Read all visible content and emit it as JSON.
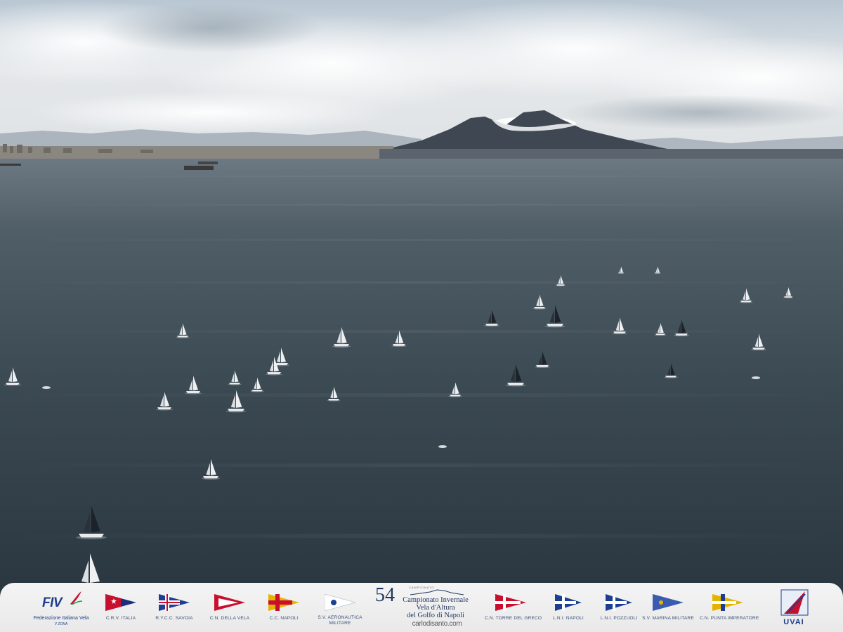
{
  "scene": {
    "description_colors": {
      "sky_top": "#c9d4de",
      "sky_horizon": "#e3e6e6",
      "sea_far": "#5e6c76",
      "sea_near": "#2b3942",
      "volcano": "#3d4652"
    }
  },
  "footer": {
    "left_logo": {
      "word": "FIV",
      "text": "Federazione Italiana Vela",
      "sub": "V ZONA"
    },
    "championship": {
      "number": "54",
      "top": "CAMPIONATO",
      "line1": "Campionato Invernale",
      "line2": "Vela d'Altura",
      "line3": "del Golfo di Napoli",
      "site": "carlodisanto.com"
    },
    "clubs": [
      {
        "label": "C.R.V. ITALIA",
        "colors": [
          "#1c2f7a",
          "#c8102e"
        ]
      },
      {
        "label": "R.Y.C.C. SAVOIA",
        "colors": [
          "#1c3f94",
          "#ffffff"
        ]
      },
      {
        "label": "C.N. DELLA VELA",
        "colors": [
          "#c8102e",
          "#ffffff"
        ]
      },
      {
        "label": "C.C. NAPOLI",
        "colors": [
          "#e6b400",
          "#c8102e"
        ]
      },
      {
        "label": "S.V. AERONAUTICA MILITARE",
        "colors": [
          "#ffffff",
          "#1c3f94"
        ]
      },
      {
        "label": "C.N. TORRE DEL GRECO",
        "colors": [
          "#c8102e",
          "#ffffff"
        ]
      },
      {
        "label": "L.N.I. NAPOLI",
        "colors": [
          "#1c3f94",
          "#ffffff"
        ]
      },
      {
        "label": "L.N.I. POZZUOLI",
        "colors": [
          "#1c3f94",
          "#ffffff"
        ]
      },
      {
        "label": "S.V. MARINA MILITARE",
        "colors": [
          "#3a5bb0",
          "#e6b400"
        ]
      },
      {
        "label": "C.N. PUNTA IMPERATORE",
        "colors": [
          "#e6b400",
          "#1c3f94"
        ]
      }
    ],
    "right_logo": {
      "word": "UVAI"
    }
  }
}
